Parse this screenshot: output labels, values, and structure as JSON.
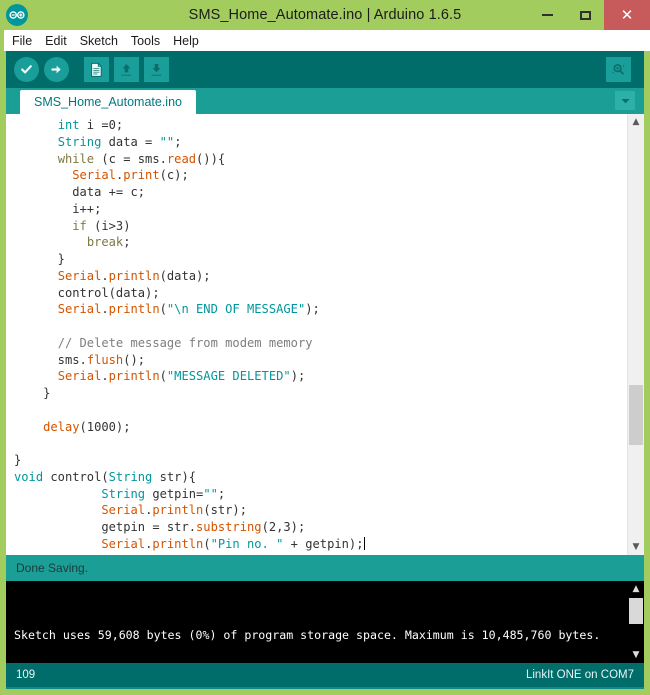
{
  "window": {
    "title": "SMS_Home_Automate.ino | Arduino 1.6.5",
    "logo_icon": "arduino-logo-icon",
    "controls": {
      "minimize": "minimize-icon",
      "maximize": "maximize-icon",
      "close": "close-icon"
    },
    "colors": {
      "titlebar": "#a3cc5e",
      "toolbar": "#006d6a",
      "tabbar": "#1a9e96",
      "accent": "#00979c",
      "close_button": "#c75b5b"
    }
  },
  "menubar": {
    "items": [
      {
        "label": "File"
      },
      {
        "label": "Edit"
      },
      {
        "label": "Sketch"
      },
      {
        "label": "Tools"
      },
      {
        "label": "Help"
      }
    ]
  },
  "toolbar": {
    "buttons": [
      {
        "name": "verify-button",
        "icon": "checkmark-icon",
        "tooltip": "Verify"
      },
      {
        "name": "upload-button",
        "icon": "arrow-right-icon",
        "tooltip": "Upload"
      },
      {
        "name": "new-button",
        "icon": "new-document-icon",
        "tooltip": "New"
      },
      {
        "name": "open-button",
        "icon": "arrow-up-icon",
        "tooltip": "Open"
      },
      {
        "name": "save-button",
        "icon": "arrow-down-icon",
        "tooltip": "Save"
      }
    ],
    "serial_monitor": {
      "name": "serial-monitor-button",
      "icon": "magnifier-icon",
      "tooltip": "Serial Monitor"
    }
  },
  "tabs": {
    "active": "SMS_Home_Automate.ino",
    "items": [
      {
        "label": "SMS_Home_Automate.ino"
      }
    ],
    "menu_icon": "chevron-down-icon"
  },
  "editor": {
    "lines": [
      [
        {
          "t": "      ",
          "c": ""
        },
        {
          "t": "int",
          "c": "k-type"
        },
        {
          "t": " i =0;",
          "c": ""
        }
      ],
      [
        {
          "t": "      ",
          "c": ""
        },
        {
          "t": "String",
          "c": "k-type"
        },
        {
          "t": " data = ",
          "c": ""
        },
        {
          "t": "\"\"",
          "c": "k-str"
        },
        {
          "t": ";",
          "c": ""
        }
      ],
      [
        {
          "t": "      ",
          "c": ""
        },
        {
          "t": "while",
          "c": "k-ctrl"
        },
        {
          "t": " (c = sms.",
          "c": ""
        },
        {
          "t": "read",
          "c": "k-func"
        },
        {
          "t": "()){",
          "c": ""
        }
      ],
      [
        {
          "t": "        ",
          "c": ""
        },
        {
          "t": "Serial",
          "c": "k-func"
        },
        {
          "t": ".",
          "c": ""
        },
        {
          "t": "print",
          "c": "k-func"
        },
        {
          "t": "(c);",
          "c": ""
        }
      ],
      [
        {
          "t": "        data += c;",
          "c": ""
        }
      ],
      [
        {
          "t": "        i++;",
          "c": ""
        }
      ],
      [
        {
          "t": "        ",
          "c": ""
        },
        {
          "t": "if",
          "c": "k-ctrl"
        },
        {
          "t": " (i>3)",
          "c": ""
        }
      ],
      [
        {
          "t": "          ",
          "c": ""
        },
        {
          "t": "break",
          "c": "k-ctrl"
        },
        {
          "t": ";",
          "c": ""
        }
      ],
      [
        {
          "t": "      }",
          "c": ""
        }
      ],
      [
        {
          "t": "      ",
          "c": ""
        },
        {
          "t": "Serial",
          "c": "k-func"
        },
        {
          "t": ".",
          "c": ""
        },
        {
          "t": "println",
          "c": "k-func"
        },
        {
          "t": "(data);",
          "c": ""
        }
      ],
      [
        {
          "t": "      control(data);",
          "c": ""
        }
      ],
      [
        {
          "t": "      ",
          "c": ""
        },
        {
          "t": "Serial",
          "c": "k-func"
        },
        {
          "t": ".",
          "c": ""
        },
        {
          "t": "println",
          "c": "k-func"
        },
        {
          "t": "(",
          "c": ""
        },
        {
          "t": "\"\\n END OF MESSAGE\"",
          "c": "k-str"
        },
        {
          "t": ");",
          "c": ""
        }
      ],
      [
        {
          "t": "",
          "c": ""
        }
      ],
      [
        {
          "t": "      ",
          "c": ""
        },
        {
          "t": "// Delete message from modem memory",
          "c": "k-com"
        }
      ],
      [
        {
          "t": "      sms.",
          "c": ""
        },
        {
          "t": "flush",
          "c": "k-func"
        },
        {
          "t": "();",
          "c": ""
        }
      ],
      [
        {
          "t": "      ",
          "c": ""
        },
        {
          "t": "Serial",
          "c": "k-func"
        },
        {
          "t": ".",
          "c": ""
        },
        {
          "t": "println",
          "c": "k-func"
        },
        {
          "t": "(",
          "c": ""
        },
        {
          "t": "\"MESSAGE DELETED\"",
          "c": "k-str"
        },
        {
          "t": ");",
          "c": ""
        }
      ],
      [
        {
          "t": "    }",
          "c": ""
        }
      ],
      [
        {
          "t": "",
          "c": ""
        }
      ],
      [
        {
          "t": "    ",
          "c": ""
        },
        {
          "t": "delay",
          "c": "k-func"
        },
        {
          "t": "(1000);",
          "c": ""
        }
      ],
      [
        {
          "t": "",
          "c": ""
        }
      ],
      [
        {
          "t": "}",
          "c": ""
        }
      ],
      [
        {
          "t": "",
          "c": ""
        },
        {
          "t": "void",
          "c": "k-type"
        },
        {
          "t": " control(",
          "c": ""
        },
        {
          "t": "String",
          "c": "k-type"
        },
        {
          "t": " str){",
          "c": ""
        }
      ],
      [
        {
          "t": "            ",
          "c": ""
        },
        {
          "t": "String",
          "c": "k-type"
        },
        {
          "t": " getpin=",
          "c": ""
        },
        {
          "t": "\"\"",
          "c": "k-str"
        },
        {
          "t": ";",
          "c": ""
        }
      ],
      [
        {
          "t": "            ",
          "c": ""
        },
        {
          "t": "Serial",
          "c": "k-func"
        },
        {
          "t": ".",
          "c": ""
        },
        {
          "t": "println",
          "c": "k-func"
        },
        {
          "t": "(str);",
          "c": ""
        }
      ],
      [
        {
          "t": "            getpin = str.",
          "c": ""
        },
        {
          "t": "substring",
          "c": "k-func"
        },
        {
          "t": "(2,3);",
          "c": ""
        }
      ],
      [
        {
          "t": "            ",
          "c": ""
        },
        {
          "t": "Serial",
          "c": "k-func"
        },
        {
          "t": ".",
          "c": ""
        },
        {
          "t": "println",
          "c": "k-func"
        },
        {
          "t": "(",
          "c": ""
        },
        {
          "t": "\"Pin no. \"",
          "c": "k-str"
        },
        {
          "t": " + getpin);",
          "c": ""
        }
      ]
    ],
    "syntax_colors": {
      "type": "#00979c",
      "control": "#7e7942",
      "function": "#d35400",
      "string": "#00979c",
      "comment": "#7e7e7e",
      "plain": "#333333"
    },
    "scrollbar": {
      "up_icon": "chevron-up-icon",
      "down_icon": "chevron-down-icon"
    }
  },
  "message": {
    "text": "Done Saving."
  },
  "console": {
    "output": "Sketch uses 59,608 bytes (0%) of program storage space. Maximum is 10,485,760 bytes.",
    "scrollbar": {
      "up_icon": "chevron-up-icon",
      "down_icon": "chevron-down-icon"
    }
  },
  "statusbar": {
    "line_number": "109",
    "board_info": "LinkIt ONE on COM7"
  }
}
